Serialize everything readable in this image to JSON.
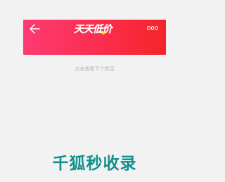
{
  "header": {
    "title": "天天低价",
    "back_icon": "back-arrow-icon",
    "more_icon": "more-options-icon",
    "gradient_colors": [
      "#fe3a73",
      "#f5242a"
    ]
  },
  "main": {
    "hint_text": "点击查看下个类目"
  },
  "footer": {
    "brand_text": "千狐秒收录",
    "brand_color": "#0f8f8b"
  }
}
